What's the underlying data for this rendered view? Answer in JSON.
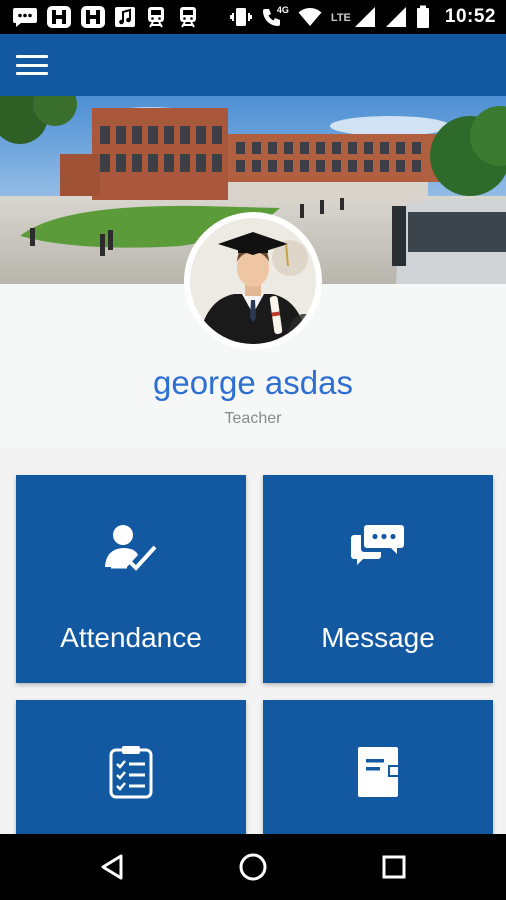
{
  "status_bar": {
    "time": "10:52",
    "network_label": "LTE",
    "wifi_label": "4G",
    "left_icons": [
      "chat-icon",
      "notification-app-icon",
      "notification-app-icon",
      "music-note-icon",
      "train-icon",
      "train-icon"
    ],
    "right_icons": [
      "vibrate-icon",
      "wifi-call-icon",
      "wifi-icon",
      "signal-icon",
      "signal-icon",
      "battery-icon"
    ]
  },
  "app_bar": {
    "menu_icon": "hamburger-menu-icon",
    "color": "#1259a1"
  },
  "profile": {
    "name": "george asdas",
    "role": "Teacher",
    "name_color": "#2f6fd1"
  },
  "tiles": [
    {
      "label": "Attendance",
      "icon": "attendance-icon"
    },
    {
      "label": "Message",
      "icon": "message-icon"
    },
    {
      "label": "",
      "icon": "checklist-icon"
    },
    {
      "label": "",
      "icon": "notebook-icon"
    }
  ],
  "nav_bar": {
    "back_icon": "back-icon",
    "home_icon": "home-icon",
    "recents_icon": "recents-icon"
  }
}
